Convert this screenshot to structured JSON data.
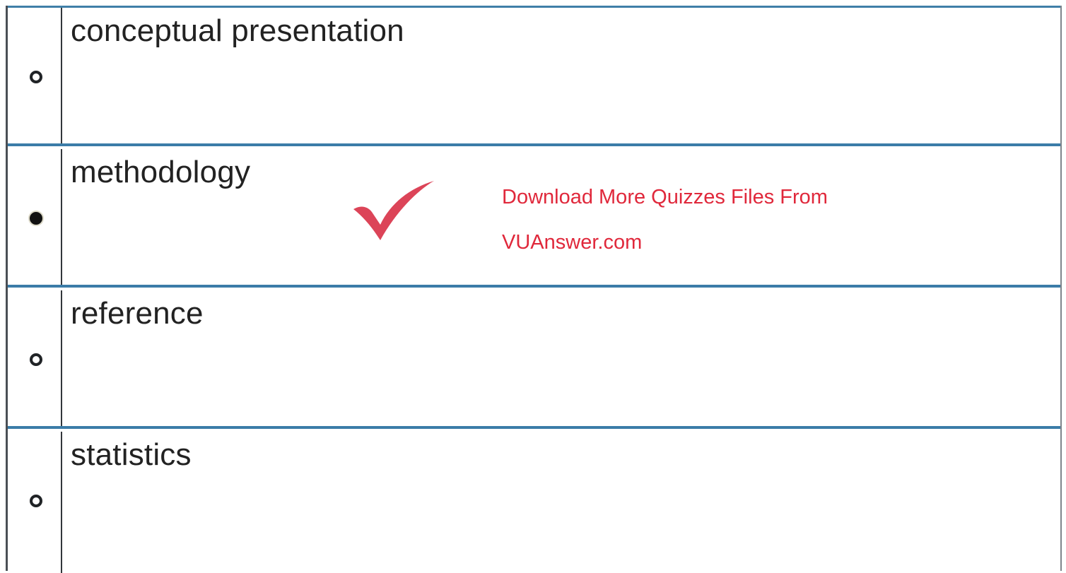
{
  "options": [
    {
      "label": "conceptual presentation",
      "selected": false
    },
    {
      "label": "methodology",
      "selected": true
    },
    {
      "label": "reference",
      "selected": false
    },
    {
      "label": "statistics",
      "selected": false
    }
  ],
  "correct_mark": {
    "icon": "checkmark-icon",
    "color": "#d9364b"
  },
  "watermark": {
    "line1": "Download More Quizzes Files From",
    "line2": "VUAnswer.com",
    "color": "#e0283b"
  }
}
